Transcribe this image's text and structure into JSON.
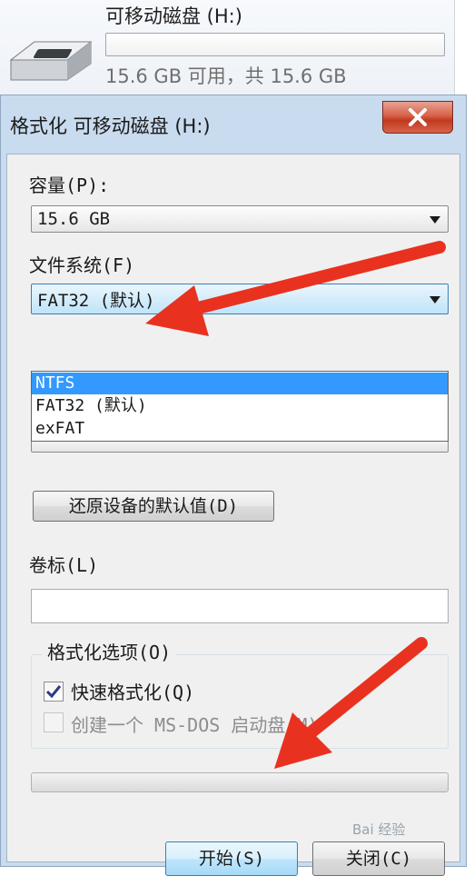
{
  "drive": {
    "name": "可移动磁盘 (H:)",
    "space": "15.6 GB 可用，共 15.6 GB"
  },
  "dialog": {
    "title": "格式化 可移动磁盘 (H:)",
    "close_label": "X",
    "capacity": {
      "label": "容量(P):",
      "value": "15.6 GB"
    },
    "filesystem": {
      "label": "文件系统(F)",
      "value": "FAT32 (默认)",
      "options": [
        "NTFS",
        "FAT32 (默认)",
        "exFAT"
      ],
      "highlighted": "NTFS"
    },
    "restore_defaults_label": "还原设备的默认值(D)",
    "volume_label": {
      "label": "卷标(L)",
      "value": ""
    },
    "format_options": {
      "title": "格式化选项(O)",
      "quick_format": {
        "label": "快速格式化(Q)",
        "checked": true
      },
      "msdos_boot": {
        "label": "创建一个 MS-DOS 启动盘(M)",
        "checked": false,
        "disabled": true
      }
    },
    "progress": 0,
    "start_label": "开始(S)",
    "close_button_label": "关闭(C)"
  },
  "watermark": "Bai 经验",
  "colors": {
    "selection": "#3399ff",
    "arrow": "#e8321f",
    "dialog_frame": "#c9dbee"
  }
}
